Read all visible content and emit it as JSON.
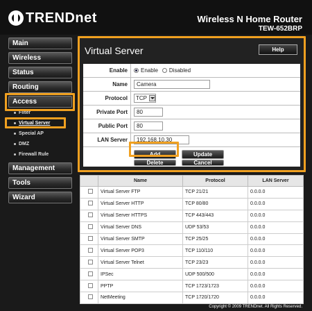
{
  "header": {
    "brand": "TRENDnet",
    "product_name": "Wireless N Home Router",
    "model": "TEW-652BRP"
  },
  "sidebar": {
    "main_items": [
      "Main",
      "Wireless",
      "Status",
      "Routing",
      "Access",
      "Management",
      "Tools",
      "Wizard"
    ],
    "active_item": "Access",
    "sub_items": [
      "Filter",
      "Virtual Server",
      "Special AP",
      "DMZ",
      "Firewall Rule"
    ],
    "active_sub_item": "Virtual Server"
  },
  "panel": {
    "title": "Virtual Server",
    "help_label": "Help",
    "form": {
      "enable_label": "Enable",
      "enable_option": "Enable",
      "disable_option": "Disabled",
      "enabled": true,
      "name_label": "Name",
      "name_value": "Camera",
      "protocol_label": "Protocol",
      "protocol_value": "TCP",
      "private_port_label": "Private Port",
      "private_port_value": "80",
      "public_port_label": "Public Port",
      "public_port_value": "80",
      "lan_server_label": "LAN Server",
      "lan_server_value": "192.168.10.30"
    },
    "buttons": {
      "add": "Add",
      "update": "Update",
      "delete": "Delete",
      "cancel": "Cancel"
    }
  },
  "table": {
    "headers": [
      "",
      "Name",
      "Protocol",
      "LAN Server"
    ],
    "rows": [
      [
        "Virtual Server FTP",
        "TCP 21/21",
        "0.0.0.0"
      ],
      [
        "Virtual Server HTTP",
        "TCP 80/80",
        "0.0.0.0"
      ],
      [
        "Virtual Server HTTPS",
        "TCP 443/443",
        "0.0.0.0"
      ],
      [
        "Virtual Server DNS",
        "UDP 53/53",
        "0.0.0.0"
      ],
      [
        "Virtual Server SMTP",
        "TCP 25/25",
        "0.0.0.0"
      ],
      [
        "Virtual Server POP3",
        "TCP 110/110",
        "0.0.0.0"
      ],
      [
        "Virtual Server Telnet",
        "TCP 23/23",
        "0.0.0.0"
      ],
      [
        "IPSec",
        "UDP 500/500",
        "0.0.0.0"
      ],
      [
        "PPTP",
        "TCP 1723/1723",
        "0.0.0.0"
      ],
      [
        "NetMeeting",
        "TCP 1720/1720",
        "0.0.0.0"
      ]
    ]
  },
  "footer": {
    "copyright": "Copyright © 2009 TRENDnet. All Rights Reserved."
  },
  "colors": {
    "highlight": "#f0a020",
    "background": "#1a1a1a"
  }
}
